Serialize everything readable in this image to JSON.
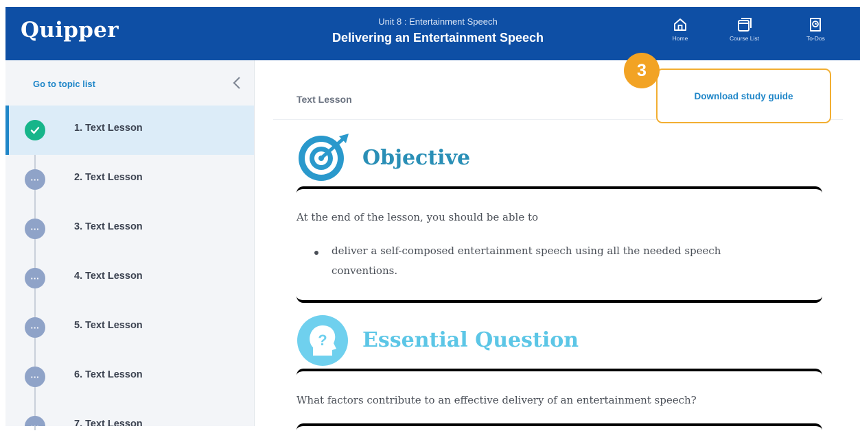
{
  "header": {
    "logo": "Quipper",
    "unit": "Unit 8 : Entertainment Speech",
    "title": "Delivering an Entertainment Speech",
    "nav": [
      {
        "label": "Home",
        "icon": "home-icon"
      },
      {
        "label": "Course List",
        "icon": "course-list-icon"
      },
      {
        "label": "To-Dos",
        "icon": "todo-icon"
      }
    ]
  },
  "sidebar": {
    "go_to_topic_list": "Go to topic list",
    "collapse_icon": "chevron-left-icon",
    "topics": [
      {
        "label": "1. Text Lesson",
        "status": "completed"
      },
      {
        "label": "2. Text Lesson",
        "status": "pending"
      },
      {
        "label": "3. Text Lesson",
        "status": "pending"
      },
      {
        "label": "4. Text Lesson",
        "status": "pending"
      },
      {
        "label": "5. Text Lesson",
        "status": "pending"
      },
      {
        "label": "6. Text Lesson",
        "status": "pending"
      },
      {
        "label": "7. Text Lesson",
        "status": "pending"
      }
    ],
    "pending_glyph": "···"
  },
  "main": {
    "breadcrumb": "Text Lesson",
    "download_label": "Download study guide",
    "callout_number": "3",
    "objective": {
      "title": "Objective",
      "intro": "At the end of the lesson, you should be able to",
      "bullets": [
        "deliver a self-composed entertainment speech using all the needed speech conventions."
      ],
      "bullet_line1": "deliver a self-composed entertainment speech using all the needed speech",
      "bullet_line2": "conventions."
    },
    "essential_question": {
      "title": "Essential Question",
      "text": "What factors contribute to an effective delivery of an entertainment speech?",
      "icon_glyph": "?"
    }
  },
  "colors": {
    "header_bg": "#0e4fa5",
    "accent_blue": "#1f86c8",
    "completed_green": "#17b58a",
    "pending_dot": "#8fa3c8",
    "callout_orange": "#f2a324",
    "objective_teal": "#2a8fb6",
    "question_cyan": "#5cc6e6"
  }
}
